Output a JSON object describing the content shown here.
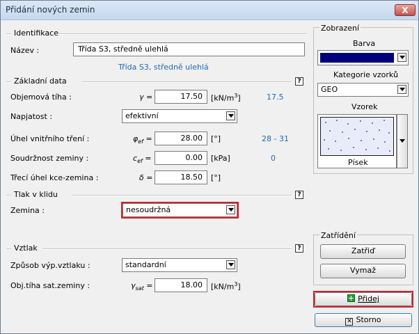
{
  "window": {
    "title": "Přidání nových zemin",
    "close_label": "X"
  },
  "identification": {
    "section_label": "Identifikace",
    "name_label": "Název :",
    "name_value": "Třída S3, středně ulehlá",
    "name_preview": "Třída S3, středně ulehlá"
  },
  "basic": {
    "section_label": "Základní data",
    "help": "?",
    "unit_weight": {
      "label": "Objemová tíha :",
      "symbol": "γ =",
      "value": "17.50",
      "unit_pre": "[kN/m",
      "unit_sup": "3",
      "unit_post": "]",
      "hint": "17.5"
    },
    "stress_state": {
      "label": "Napjatost :",
      "value": "efektivní"
    },
    "friction_angle": {
      "label": "Úhel vnitřního tření :",
      "symbol": "φ",
      "sub": "ef",
      "eq": " =",
      "value": "28.00",
      "unit": "[°]",
      "hint": "28 - 31"
    },
    "cohesion": {
      "label": "Soudržnost zeminy :",
      "symbol": "c",
      "sub": "ef",
      "eq": " =",
      "value": "0.00",
      "unit": "[kPa]",
      "hint": "0"
    },
    "struct_friction": {
      "label": "Třecí úhel kce-zemina :",
      "symbol": "δ =",
      "value": "18.50",
      "unit": "[°]"
    }
  },
  "earth_pressure": {
    "section_label": "Tlak v klidu",
    "help": "?",
    "soil_label": "Zemina :",
    "soil_value": "nesoudržná"
  },
  "uplift": {
    "section_label": "Vztlak",
    "help": "?",
    "method_label": "Způsob výp.vztlaku :",
    "method_value": "standardní",
    "sat_label": "Obj.tíha sat.zeminy :",
    "sat_symbol": "γ",
    "sat_sub": "sat",
    "sat_eq": " =",
    "sat_value": "18.00",
    "sat_unit_pre": "[kN/m",
    "sat_unit_sup": "3",
    "sat_unit_post": "]"
  },
  "display": {
    "section_label": "Zobrazení",
    "color_label": "Barva",
    "color_value": "#00007a",
    "category_label": "Kategorie vzorků",
    "category_value": "GEO",
    "pattern_label": "Vzorek",
    "pattern_name": "Písek"
  },
  "classification": {
    "section_label": "Zatřídění",
    "classify_button": "Zatřiď",
    "clear_button": "Vymaž"
  },
  "actions": {
    "add_button": "Přidej",
    "cancel_button": "Storno"
  },
  "colors": {
    "highlight": "#d3202a",
    "hint_blue": "#1e6ab3",
    "add_icon": "#2e9a3a"
  }
}
